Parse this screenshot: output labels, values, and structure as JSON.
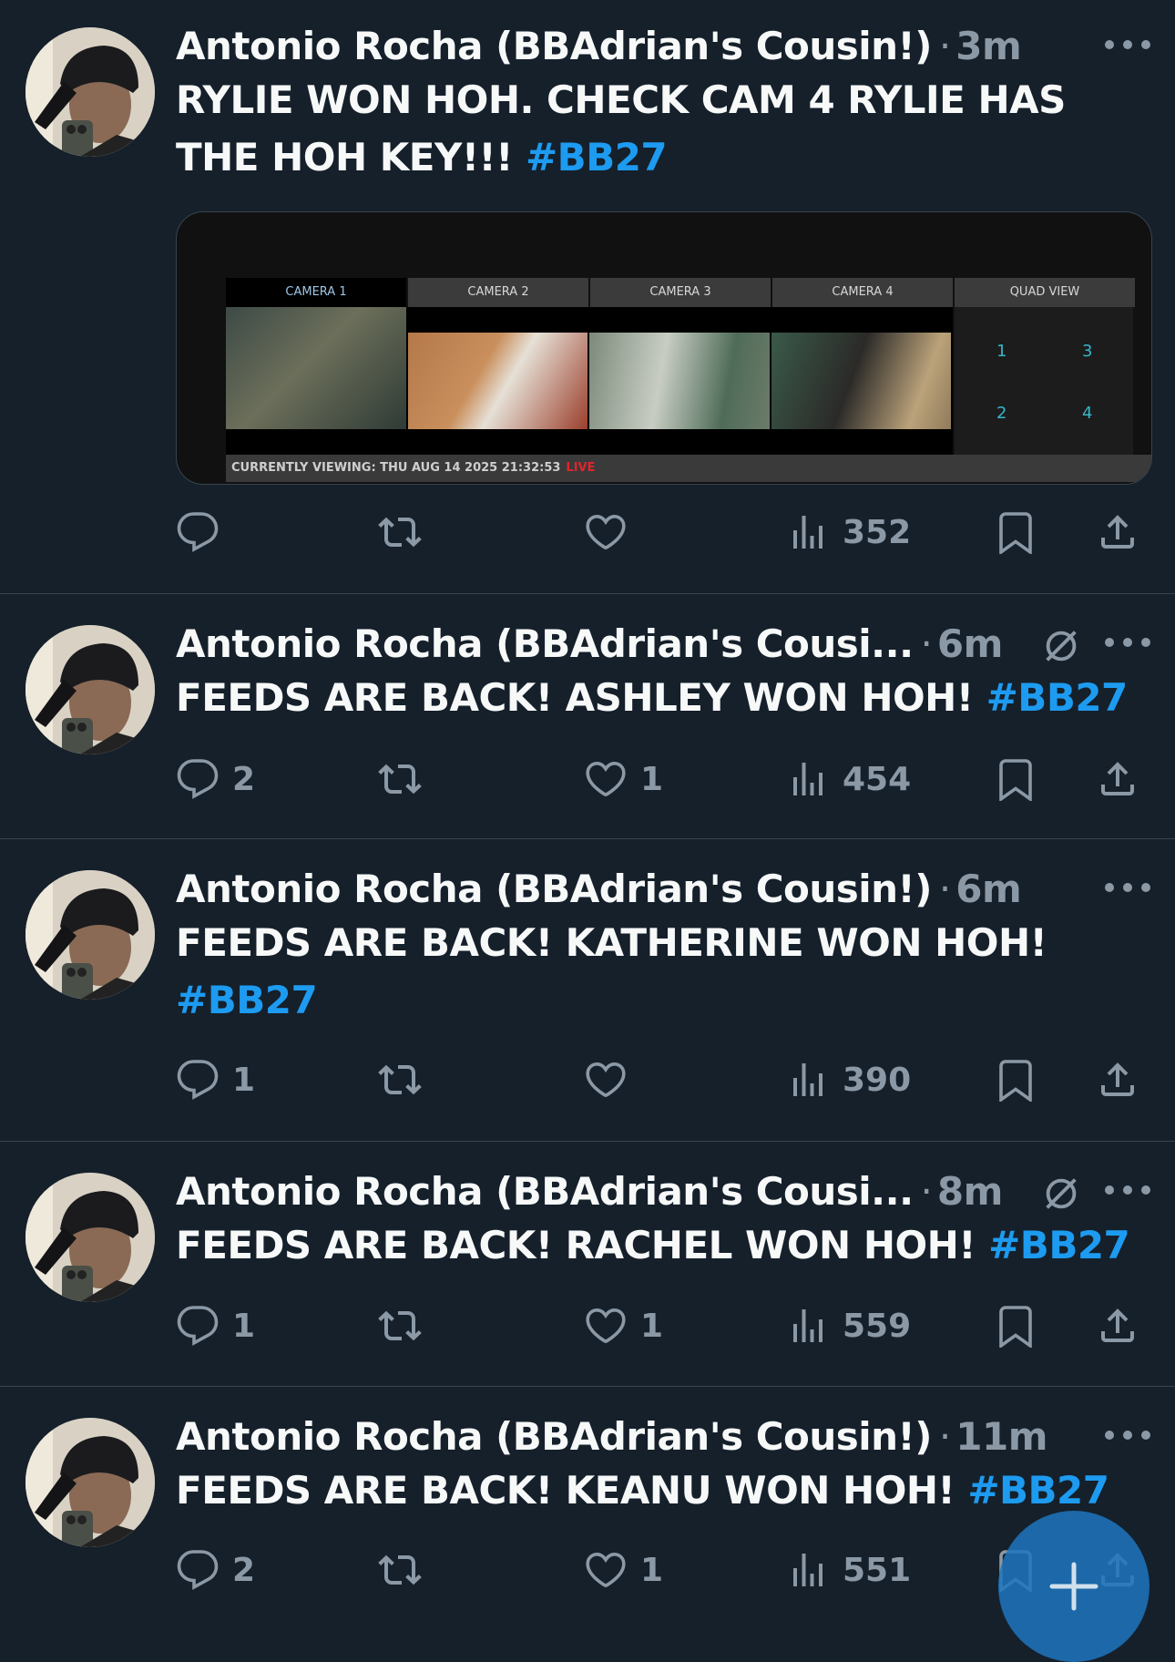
{
  "tweets": [
    {
      "name": "Antonio Rocha (BBAdrian's Cousin!)",
      "time": "3m",
      "text": "RYLIE WON HOH. CHECK CAM 4 RYLIE HAS THE HOH KEY!!! ",
      "hashtag": "#BB27",
      "replies": "",
      "likes": "",
      "views": "352",
      "media": {
        "tabs": [
          "CAMERA 1",
          "CAMERA 2",
          "CAMERA 3",
          "CAMERA 4",
          "QUAD VIEW"
        ],
        "quad_numbers": [
          "1",
          "3",
          "2",
          "4"
        ],
        "status": "CURRENTLY VIEWING: THU AUG 14 2025 21:32:53",
        "live": "LIVE"
      }
    },
    {
      "name": "Antonio Rocha (BBAdrian's Cousi...",
      "time": "6m",
      "text": "FEEDS ARE BACK! ASHLEY WON HOH! ",
      "hashtag": "#BB27",
      "replies": "2",
      "likes": "1",
      "views": "454"
    },
    {
      "name": "Antonio Rocha (BBAdrian's Cousin!)",
      "time": "6m",
      "text": "FEEDS ARE BACK! KATHERINE WON HOH! ",
      "hashtag": "#BB27",
      "replies": "1",
      "likes": "",
      "views": "390"
    },
    {
      "name": "Antonio Rocha (BBAdrian's Cousi...",
      "time": "8m",
      "text": "FEEDS ARE BACK! RACHEL WON HOH! ",
      "hashtag": "#BB27",
      "replies": "1",
      "likes": "1",
      "views": "559"
    },
    {
      "name": "Antonio Rocha (BBAdrian's Cousin!)",
      "time": "11m",
      "text": "FEEDS ARE BACK! KEANU WON HOH! ",
      "hashtag": "#BB27",
      "replies": "2",
      "likes": "1",
      "views": "551"
    }
  ],
  "dot": "·",
  "icons": {
    "reply": "reply-icon",
    "retweet": "retweet-icon",
    "like": "heart-icon",
    "views": "views-icon",
    "bookmark": "bookmark-icon",
    "share": "share-icon",
    "more": "more-icon",
    "mute": "muted-icon",
    "compose": "plus-icon"
  },
  "colors": {
    "background": "#15202b",
    "hashtag": "#1d9bf0",
    "muted": "#8b98a5",
    "fab": "#1d76be"
  }
}
